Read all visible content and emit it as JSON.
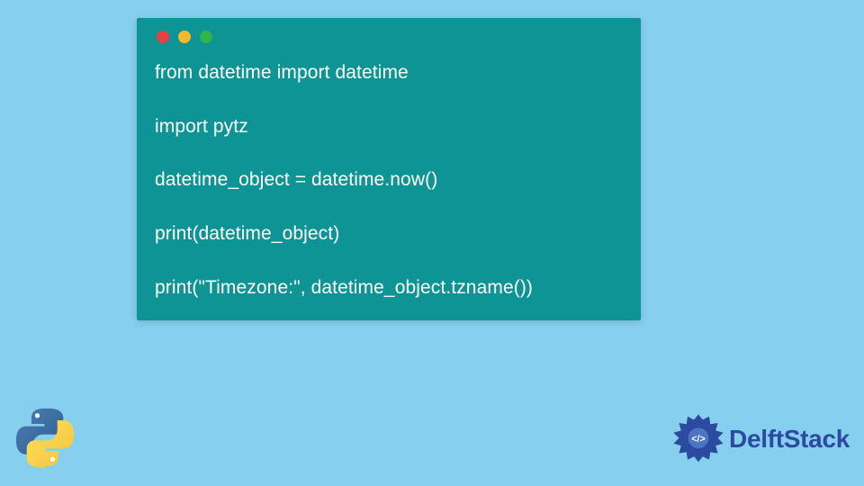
{
  "code": {
    "lines": [
      "from datetime import datetime",
      "",
      "import pytz",
      "",
      "datetime_object = datetime.now()",
      "",
      "print(datetime_object)",
      "",
      "print(\"Timezone:\", datetime_object.tzname())"
    ]
  },
  "traffic_lights": {
    "red": "#e34242",
    "yellow": "#f2b92f",
    "green": "#2fb54a"
  },
  "brand": {
    "name": "DelftStack",
    "color": "#2b4aa0"
  },
  "language_icon": "python-logo"
}
